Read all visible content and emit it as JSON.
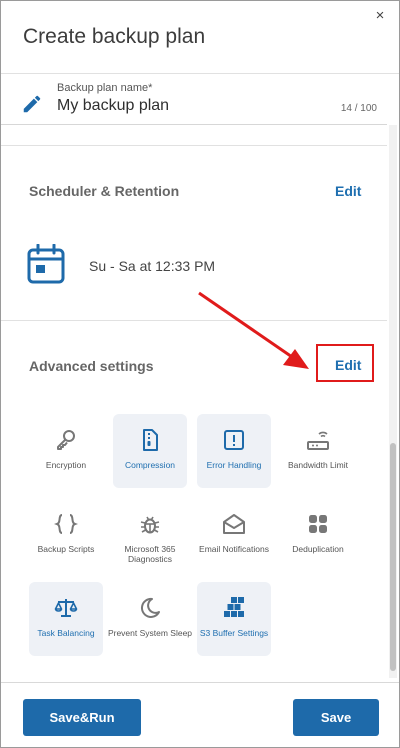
{
  "dialog": {
    "title": "Create backup plan",
    "close_glyph": "×"
  },
  "plan_name": {
    "label": "Backup plan name*",
    "value": "My backup plan",
    "counter": "14 / 100",
    "icon": "pencil-icon"
  },
  "scheduler": {
    "title": "Scheduler & Retention",
    "edit_label": "Edit",
    "schedule_text": "Su - Sa at 12:33 PM",
    "icon": "calendar-icon"
  },
  "advanced": {
    "title": "Advanced settings",
    "edit_label": "Edit",
    "highlight_color": "#e01b1b",
    "tiles": [
      {
        "label": "Encryption",
        "icon": "key-icon",
        "active": false
      },
      {
        "label": "Compression",
        "icon": "zip-file-icon",
        "active": true
      },
      {
        "label": "Error Handling",
        "icon": "exclamation-icon",
        "active": true
      },
      {
        "label": "Bandwidth Limit",
        "icon": "router-icon",
        "active": false
      },
      {
        "label": "Backup Scripts",
        "icon": "braces-icon",
        "active": false
      },
      {
        "label": "Microsoft 365 Diagnostics",
        "icon": "bug-icon",
        "active": false
      },
      {
        "label": "Email Notifications",
        "icon": "envelope-icon",
        "active": false
      },
      {
        "label": "Deduplication",
        "icon": "grid-icon",
        "active": false
      },
      {
        "label": "Task Balancing",
        "icon": "scales-icon",
        "active": true
      },
      {
        "label": "Prevent System Sleep",
        "icon": "moon-icon",
        "active": false
      },
      {
        "label": "S3 Buffer Settings",
        "icon": "cubes-icon",
        "active": true
      }
    ]
  },
  "footer": {
    "save_run_label": "Save&Run",
    "save_label": "Save"
  },
  "colors": {
    "accent": "#1e6aaa",
    "link": "#1f6fb0",
    "tile_active_bg": "#eef1f6"
  }
}
